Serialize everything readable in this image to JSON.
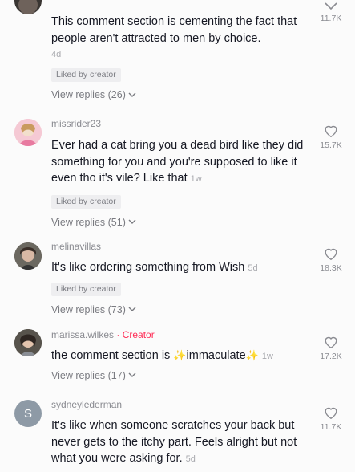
{
  "comments": [
    {
      "username": "",
      "text": "This comment section is cementing the fact that people aren't attracted to men by choice.",
      "time": "4d",
      "liked_by_creator": "Liked by creator",
      "replies": "View replies (26)",
      "likes": "11.7K"
    },
    {
      "username": "missrider23",
      "text": "Ever had a cat bring you a dead bird like they did something for you and you're supposed to like it even tho it's vile? Like that",
      "time": "1w",
      "liked_by_creator": "Liked by creator",
      "replies": "View replies (51)",
      "likes": "15.7K"
    },
    {
      "username": "melinavillas",
      "text": "It's like ordering something from Wish",
      "time": "5d",
      "liked_by_creator": "Liked by creator",
      "replies": "View replies (73)",
      "likes": "18.3K"
    },
    {
      "username": "marissa.wilkes",
      "creator_tag": "· Creator",
      "text_before": "the comment section is",
      "text_emph": "immaculate",
      "sparkle": "✨",
      "time": "1w",
      "replies": "View replies (17)",
      "likes": "17.2K"
    },
    {
      "username": "sydneylederman",
      "avatar_initial": "S",
      "text": "It's like when someone scratches your back but never gets to the itchy part. Feels alright but not what you were asking for.",
      "time": "5d",
      "likes": "11.7K"
    }
  ],
  "icons": {
    "heart": "heart-outline-icon",
    "chevron": "chevron-down-icon"
  },
  "colors": {
    "creator_tag": "#fe2c55",
    "avatar_s_bg": "#8e9aa6"
  }
}
